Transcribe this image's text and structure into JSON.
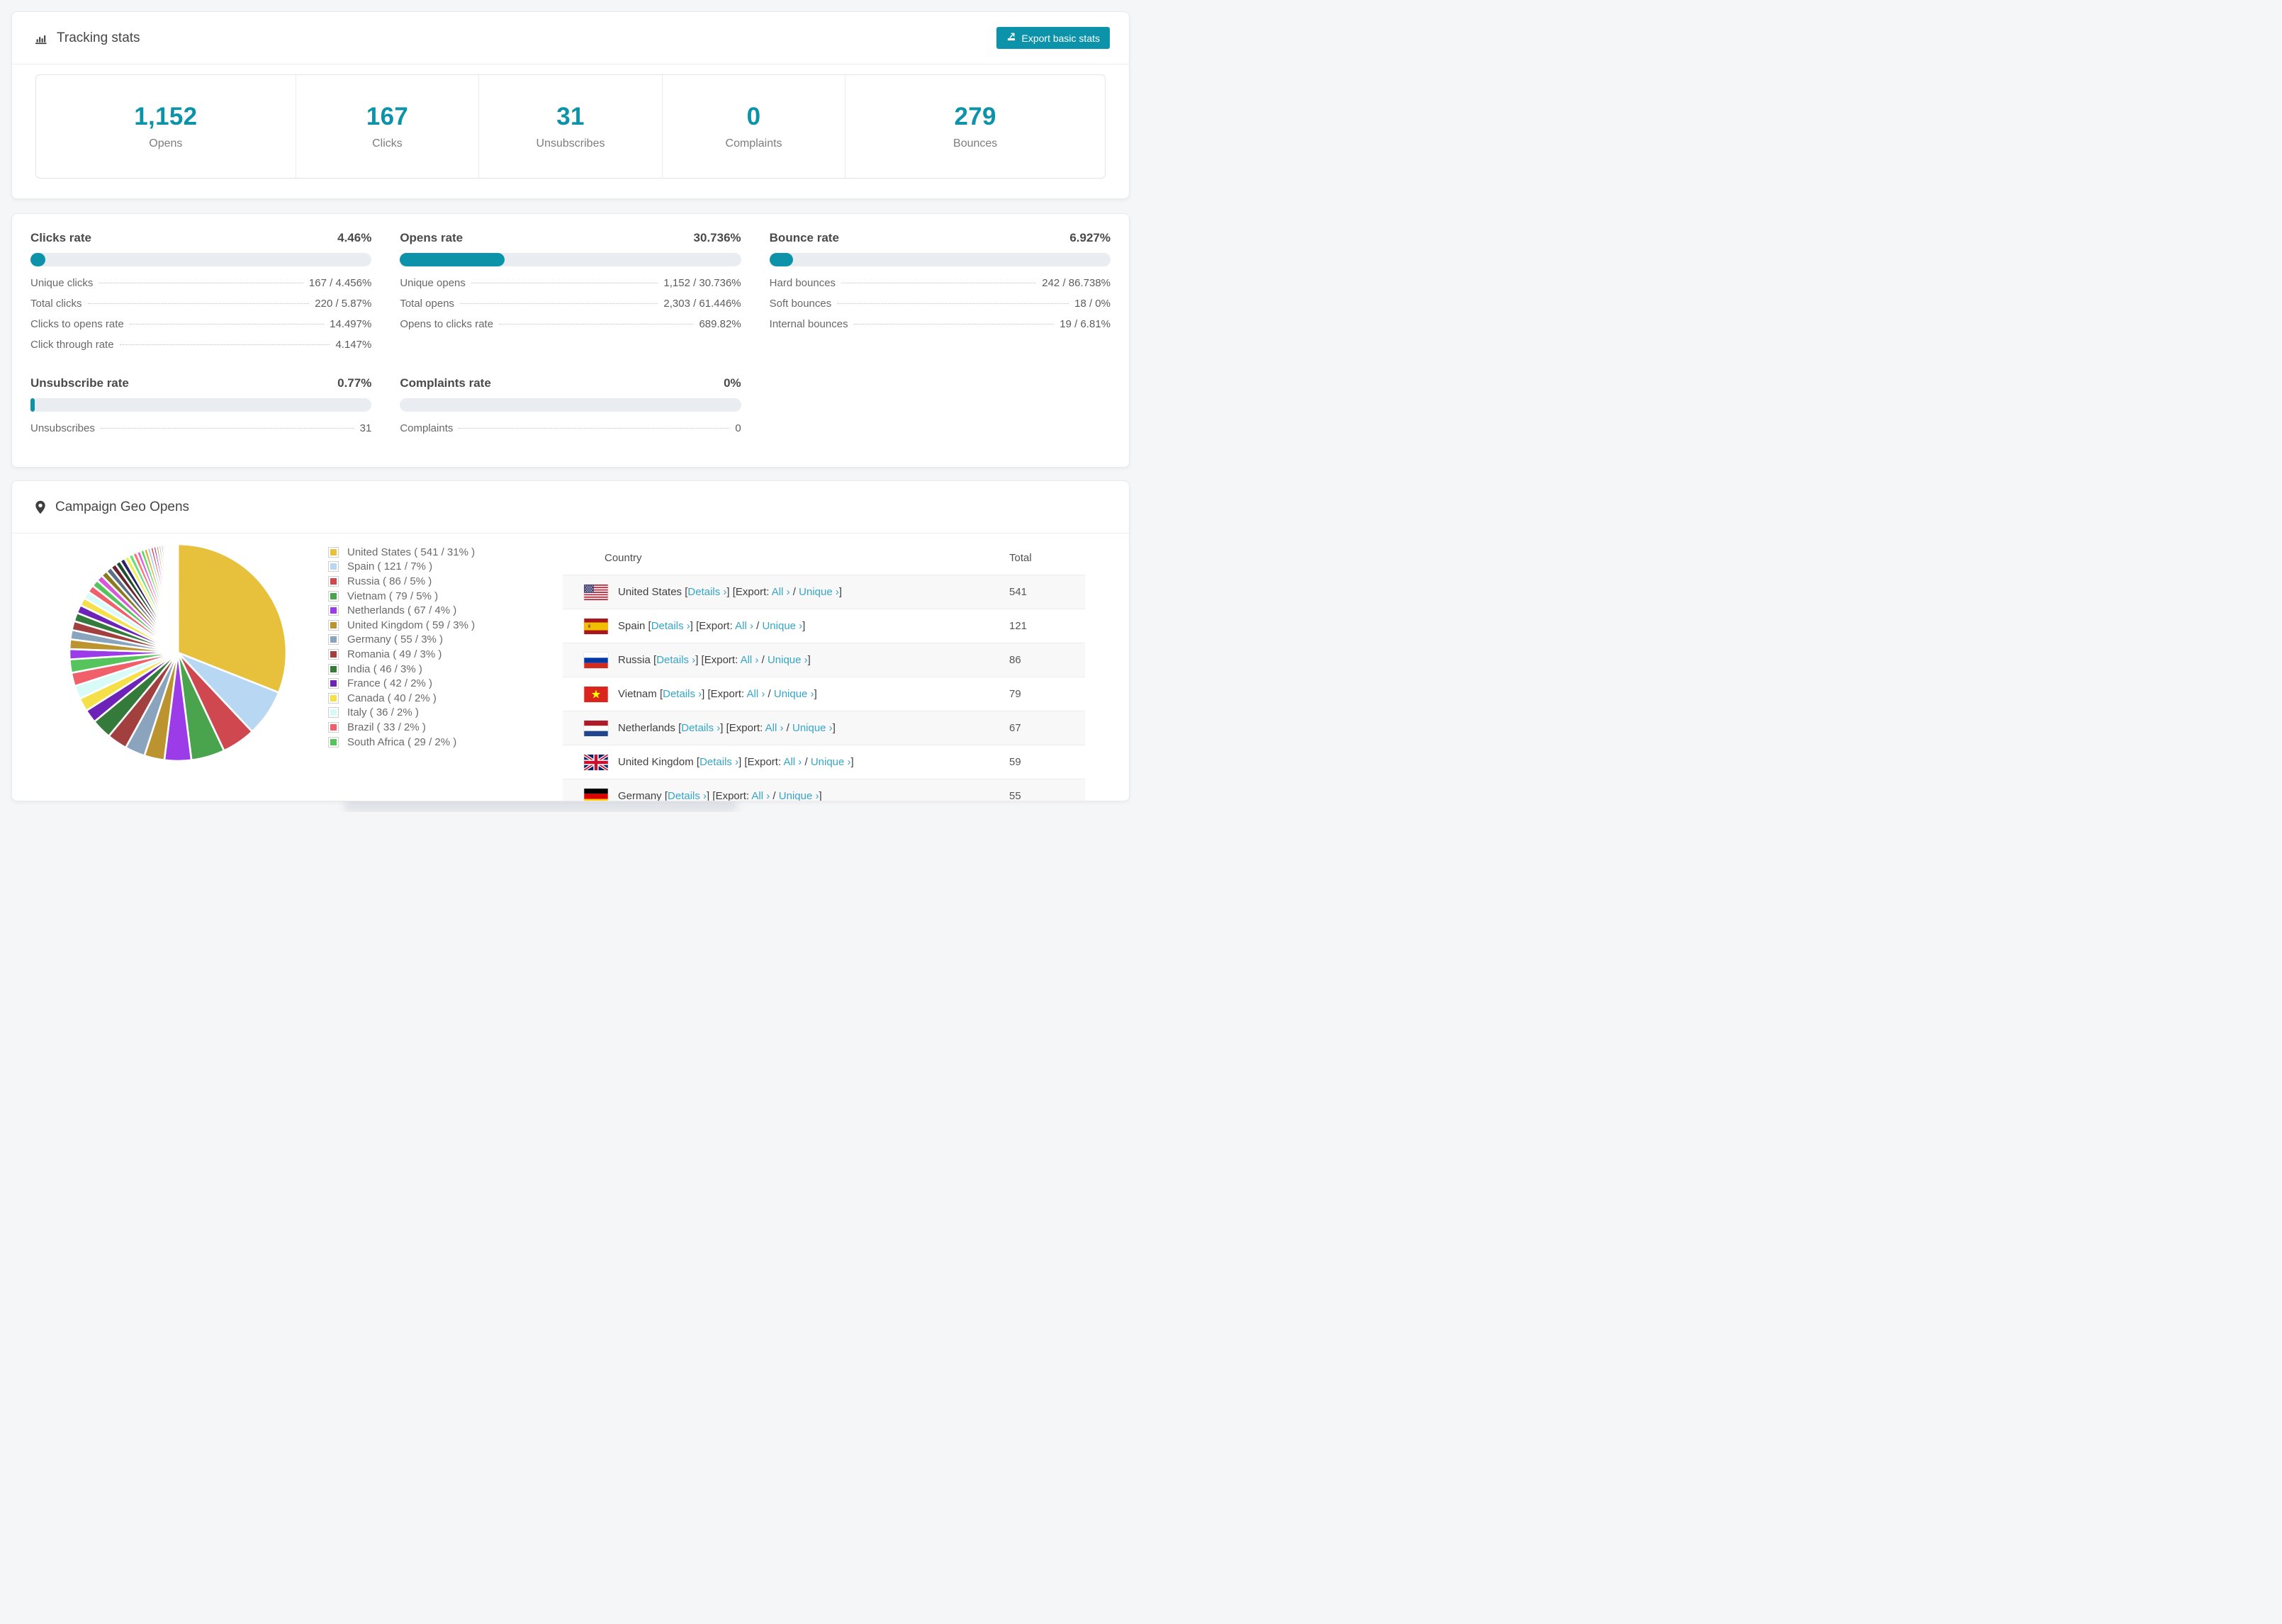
{
  "colors": {
    "accent": "#0d93a9",
    "link": "#37a5c8",
    "bar_track": "#e9ecf0"
  },
  "tracking": {
    "title": "Tracking stats",
    "export_button": "Export basic stats",
    "summary": [
      {
        "value": "1,152",
        "label": "Opens"
      },
      {
        "value": "167",
        "label": "Clicks"
      },
      {
        "value": "31",
        "label": "Unsubscribes"
      },
      {
        "value": "0",
        "label": "Complaints"
      },
      {
        "value": "279",
        "label": "Bounces"
      }
    ]
  },
  "rates": {
    "blocks": [
      {
        "title": "Clicks rate",
        "value": "4.46%",
        "pct": 4.46,
        "rows": [
          {
            "label": "Unique clicks",
            "value": "167 / 4.456%"
          },
          {
            "label": "Total clicks",
            "value": "220 / 5.87%"
          },
          {
            "label": "Clicks to opens rate",
            "value": "14.497%"
          },
          {
            "label": "Click through rate",
            "value": "4.147%"
          }
        ]
      },
      {
        "title": "Opens rate",
        "value": "30.736%",
        "pct": 30.736,
        "rows": [
          {
            "label": "Unique opens",
            "value": "1,152 / 30.736%"
          },
          {
            "label": "Total opens",
            "value": "2,303 / 61.446%"
          },
          {
            "label": "Opens to clicks rate",
            "value": "689.82%"
          }
        ]
      },
      {
        "title": "Bounce rate",
        "value": "6.927%",
        "pct": 6.927,
        "rows": [
          {
            "label": "Hard bounces",
            "value": "242 / 86.738%"
          },
          {
            "label": "Soft bounces",
            "value": "18 / 0%"
          },
          {
            "label": "Internal bounces",
            "value": "19 / 6.81%"
          }
        ]
      },
      {
        "title": "Unsubscribe rate",
        "value": "0.77%",
        "pct": 0.77,
        "rows": [
          {
            "label": "Unsubscribes",
            "value": "31"
          }
        ]
      },
      {
        "title": "Complaints rate",
        "value": "0%",
        "pct": 0,
        "rows": [
          {
            "label": "Complaints",
            "value": "0"
          }
        ]
      }
    ]
  },
  "geo": {
    "title": "Campaign Geo Opens",
    "table": {
      "headers": [
        "Country",
        "Total"
      ],
      "link_details": "Details ›",
      "export_label": "Export:",
      "link_all": "All ›",
      "link_unique": "Unique ›",
      "rows": [
        {
          "country": "United States",
          "flag": "us",
          "total": "541"
        },
        {
          "country": "Spain",
          "flag": "es",
          "total": "121"
        },
        {
          "country": "Russia",
          "flag": "ru",
          "total": "86"
        },
        {
          "country": "Vietnam",
          "flag": "vn",
          "total": "79"
        },
        {
          "country": "Netherlands",
          "flag": "nl",
          "total": "67"
        },
        {
          "country": "United Kingdom",
          "flag": "gb",
          "total": "59"
        },
        {
          "country": "Germany",
          "flag": "de",
          "total": "55"
        }
      ]
    }
  },
  "chart_data": {
    "type": "pie",
    "title": "Campaign Geo Opens",
    "start_angle": 0,
    "direction": "clockwise",
    "legend_position": "right",
    "series": [
      {
        "name": "United States",
        "value": 541,
        "pct": 31,
        "color": "#e7c03c"
      },
      {
        "name": "Spain",
        "value": 121,
        "pct": 7,
        "color": "#b8d7f2"
      },
      {
        "name": "Russia",
        "value": 86,
        "pct": 5,
        "color": "#cf4850"
      },
      {
        "name": "Vietnam",
        "value": 79,
        "pct": 5,
        "color": "#4aa44e"
      },
      {
        "name": "Netherlands",
        "value": 67,
        "pct": 4,
        "color": "#9c3ce8"
      },
      {
        "name": "United Kingdom",
        "value": 59,
        "pct": 3,
        "color": "#bb9430"
      },
      {
        "name": "Germany",
        "value": 55,
        "pct": 3,
        "color": "#8aa4bd"
      },
      {
        "name": "Romania",
        "value": 49,
        "pct": 3,
        "color": "#a23f3f"
      },
      {
        "name": "India",
        "value": 46,
        "pct": 3,
        "color": "#347a3b"
      },
      {
        "name": "France",
        "value": 42,
        "pct": 2,
        "color": "#6d22b8"
      },
      {
        "name": "Canada",
        "value": 40,
        "pct": 2,
        "color": "#f6e049"
      },
      {
        "name": "Italy",
        "value": 36,
        "pct": 2,
        "color": "#d8fbf8"
      },
      {
        "name": "Brazil",
        "value": 33,
        "pct": 2,
        "color": "#f0606a"
      },
      {
        "name": "South Africa",
        "value": 29,
        "pct": 2,
        "color": "#56c45d"
      }
    ],
    "others": {
      "total_pct": 26,
      "slice_count": 46,
      "palette": [
        "#9c3ce8",
        "#bb9430",
        "#8aa4bd",
        "#a23f3f",
        "#347a3b",
        "#6d22b8",
        "#f6e049",
        "#d8fbf8",
        "#f0606a",
        "#56c45d",
        "#d957d9",
        "#8a7a1f",
        "#5a7086",
        "#6b2430",
        "#1e4d2b",
        "#2a2367",
        "#eef04e",
        "#66e07a",
        "#ff7070",
        "#e060e0",
        "#4cdb4c",
        "#d4a82e",
        "#9cc8ee",
        "#e84848"
      ]
    }
  }
}
